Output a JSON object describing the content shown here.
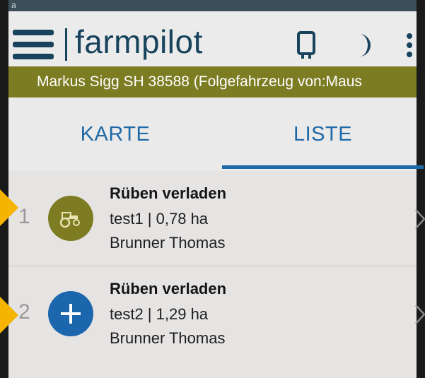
{
  "statusbar": {
    "indicator": "a"
  },
  "app": {
    "title": "farmpilot"
  },
  "header_icons": {
    "device": "tablet-device-icon",
    "theme": "moon-icon",
    "more": "more-vertical-icon"
  },
  "vehicle_bar": {
    "text": "Markus Sigg SH 38588 (Folgefahrzeug von:Maus"
  },
  "tabs": [
    {
      "label": "KARTE",
      "active": false
    },
    {
      "label": "LISTE",
      "active": true
    }
  ],
  "jobs": [
    {
      "number": "1",
      "icon": "tractor-icon",
      "icon_color": "#7e7c23",
      "title": "Rüben verladen",
      "subtitle": "test1  |  0,78 ha",
      "person": "Brunner Thomas"
    },
    {
      "number": "2",
      "icon": "plus-icon",
      "icon_color": "#1c66ad",
      "title": "Rüben verladen",
      "subtitle": "test2  |  1,29 ha",
      "person": "Brunner Thomas"
    }
  ],
  "colors": {
    "primary": "#17435c",
    "accent": "#1e69a8",
    "vehicle_bar": "#7c7c23",
    "arrow_marker": "#f4b400"
  }
}
